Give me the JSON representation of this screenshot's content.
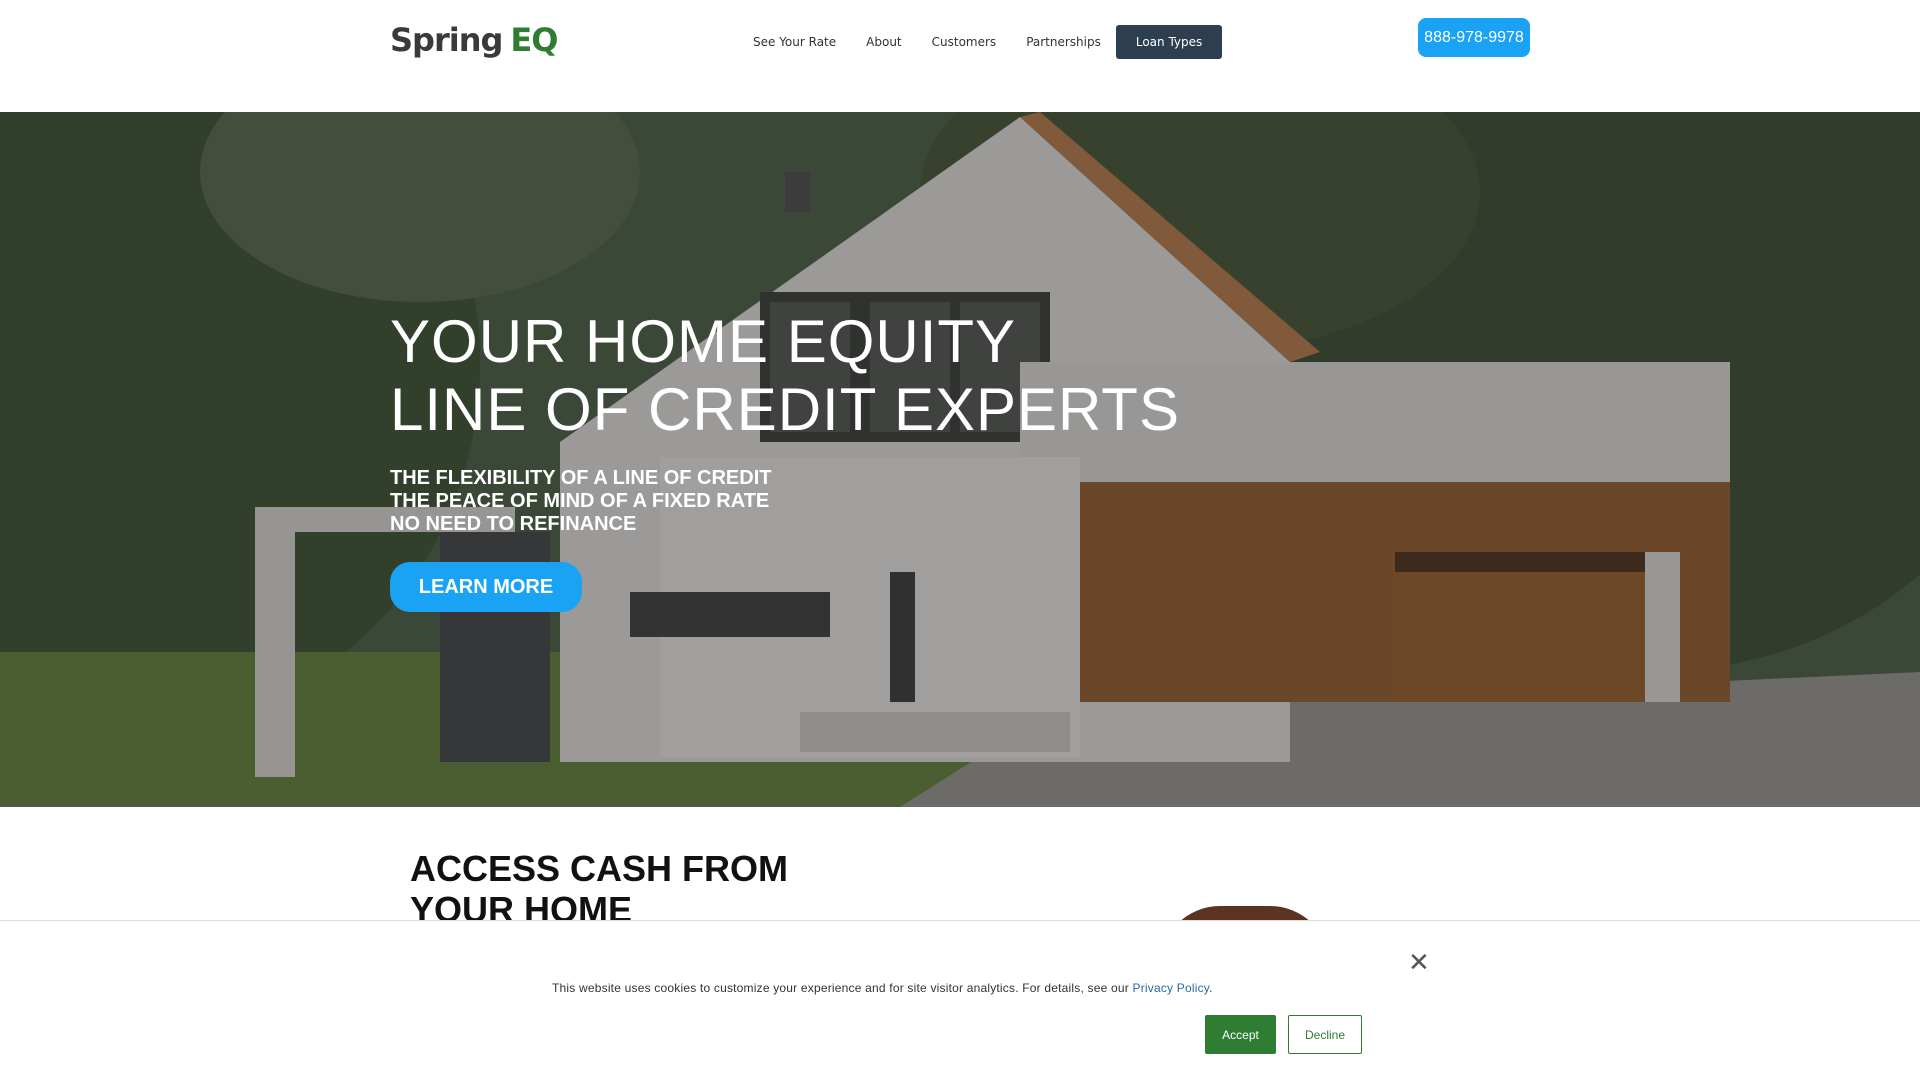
{
  "header": {
    "logo_part1": "Spring",
    "logo_part2": "EQ",
    "nav": [
      {
        "label": "See Your Rate"
      },
      {
        "label": "About"
      },
      {
        "label": "Customers"
      },
      {
        "label": "Partnerships"
      },
      {
        "label": "Loan Types"
      }
    ],
    "phone": "888-978-9978"
  },
  "hero": {
    "title_line1": "YOUR HOME EQUITY",
    "title_line2": "LINE OF CREDIT EXPERTS",
    "sub_line1": "THE FLEXIBILITY OF A LINE OF CREDIT",
    "sub_line2": "THE PEACE OF MIND OF A FIXED RATE",
    "sub_line3": "NO NEED TO REFINANCE",
    "cta": "LEARN MORE"
  },
  "section": {
    "title_line1": "ACCESS CASH FROM",
    "title_line2": "YOUR HOME"
  },
  "cookie": {
    "text": "This website uses cookies to customize your experience and for site visitor analytics. For details, see our ",
    "link": "Privacy Policy",
    "period": ".",
    "accept": "Accept",
    "decline": "Decline",
    "close_icon": "close-icon"
  },
  "colors": {
    "brand_green": "#2e7d32",
    "accent_blue": "#1aa3f5",
    "nav_active": "#2c3e50"
  }
}
